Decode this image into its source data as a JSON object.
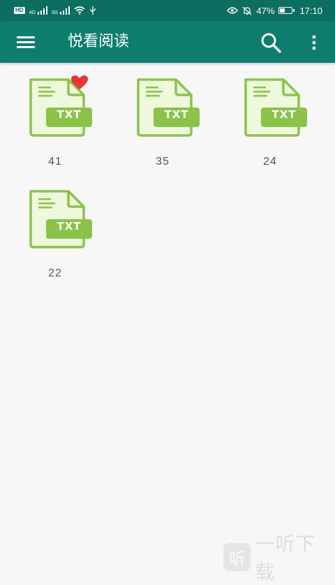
{
  "status_bar": {
    "hd": "HD",
    "signal1_type": "4G",
    "signal2_type": "3G",
    "battery_percent": "47%",
    "battery_level": 0.47,
    "time": "17:10",
    "icons": [
      "hd-icon",
      "signal-icon",
      "wifi-icon",
      "usb-icon",
      "eye-icon",
      "bell-off-icon",
      "battery-icon"
    ]
  },
  "app_bar": {
    "title": "悦看阅读",
    "menu_icon": "hamburger-menu-icon",
    "search_icon": "search-icon",
    "more_icon": "more-vert-icon"
  },
  "files": [
    {
      "label": "41",
      "badge": "TXT",
      "favorite": true
    },
    {
      "label": "35",
      "badge": "TXT",
      "favorite": false
    },
    {
      "label": "24",
      "badge": "TXT",
      "favorite": false
    },
    {
      "label": "22",
      "badge": "TXT",
      "favorite": false
    }
  ],
  "colors": {
    "app_bar": "#0f7d6e",
    "status_bar": "#0b6e61",
    "file_green": "#8bc34a",
    "file_fill": "#eef8dc",
    "heart": "#e53935"
  },
  "watermark": {
    "logo_char": "听",
    "text": "一听下载"
  }
}
